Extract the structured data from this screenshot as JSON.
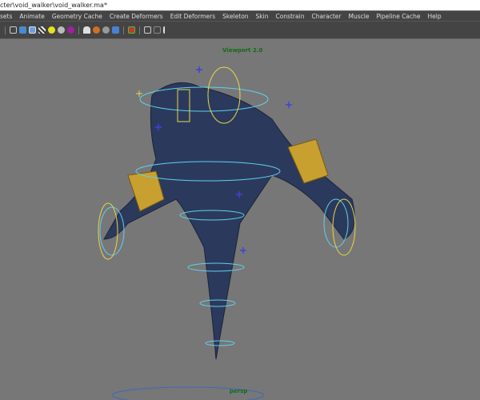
{
  "window": {
    "title": "cter\\void_walker\\void_walker.ma*"
  },
  "menu": [
    "sets",
    "Animate",
    "Geometry Cache",
    "Create Deformers",
    "Edit Deformers",
    "Skeleton",
    "Skin",
    "Constrain",
    "Character",
    "Muscle",
    "Pipeline Cache",
    "Help"
  ],
  "toolbar": {
    "icons": [
      "wireframe-icon",
      "smooth-shade-icon",
      "shade-wireframe-icon",
      "textured-icon",
      "light-default-icon",
      "light-all-icon",
      "light-selected-icon",
      "camera-icon",
      "shadow-icon",
      "ao-icon",
      "motion-blur-icon",
      "isolate-select-icon",
      "xray-icon",
      "xray-joints-icon",
      "share-icon"
    ]
  },
  "viewport": {
    "renderer_label": "Viewport 2.0",
    "camera_label": "persp"
  },
  "colors": {
    "viewport_bg": "#777777",
    "label_green": "#136b13",
    "controls_cyan": "#5fd0f0",
    "controls_yellow": "#e8d84a",
    "mesh": "#2b3a5c"
  }
}
